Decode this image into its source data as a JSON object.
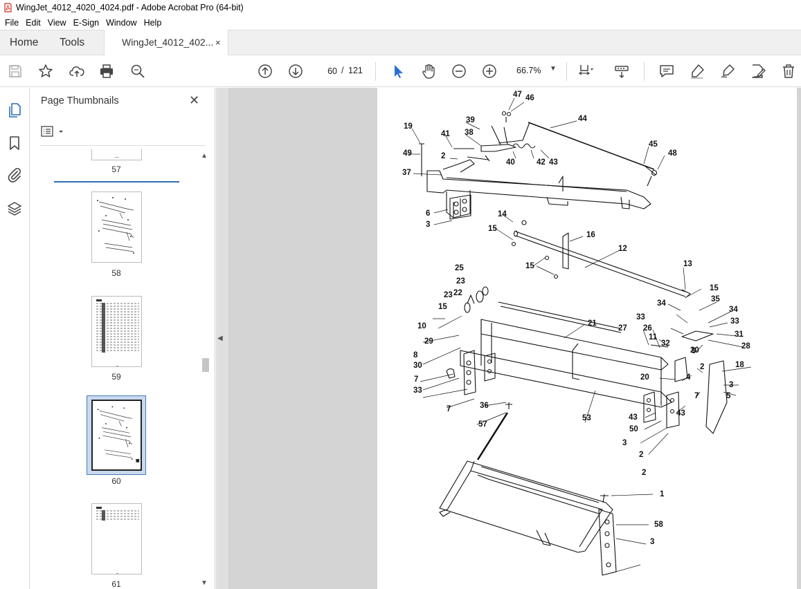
{
  "window": {
    "title": "WingJet_4012_4020_4024.pdf - Adobe Acrobat Pro (64-bit)"
  },
  "menu": [
    "File",
    "Edit",
    "View",
    "E-Sign",
    "Window",
    "Help"
  ],
  "tabs": {
    "home": "Home",
    "tools": "Tools",
    "document": "WingJet_4012_402...",
    "close_glyph": "×"
  },
  "toolbar": {
    "page_current": "60",
    "page_separator": "/",
    "page_total": "121",
    "zoom": "66.7%"
  },
  "thumbnails_panel": {
    "title": "Page Thumbnails",
    "close_glyph": "✕",
    "pages": [
      {
        "label": "57"
      },
      {
        "label": "58"
      },
      {
        "label": "59"
      },
      {
        "label": "60",
        "selected": true
      },
      {
        "label": "61"
      }
    ]
  },
  "figure": {
    "callouts": [
      "47",
      "46",
      "44",
      "19",
      "41",
      "39",
      "38",
      "45",
      "48",
      "49",
      "2",
      "40",
      "42",
      "43",
      "37",
      "6",
      "3",
      "14",
      "15",
      "16",
      "12",
      "15",
      "13",
      "15",
      "25",
      "23",
      "22",
      "23",
      "15",
      "35",
      "34",
      "34",
      "33",
      "2",
      "21",
      "33",
      "10",
      "27",
      "26",
      "31",
      "29",
      "11",
      "28",
      "32",
      "8",
      "9",
      "30",
      "20",
      "7",
      "18",
      "2",
      "20",
      "4",
      "33",
      "3",
      "7",
      "7",
      "36",
      "5",
      "53",
      "43",
      "43",
      "50",
      "57",
      "3",
      "2",
      "1",
      "58",
      "3"
    ]
  },
  "colors": {
    "accent_blue": "#2d6db5",
    "pointer_blue": "#2a6fd6",
    "pdf_red": "#d6281c",
    "doc_background": "#d4d4d4"
  }
}
